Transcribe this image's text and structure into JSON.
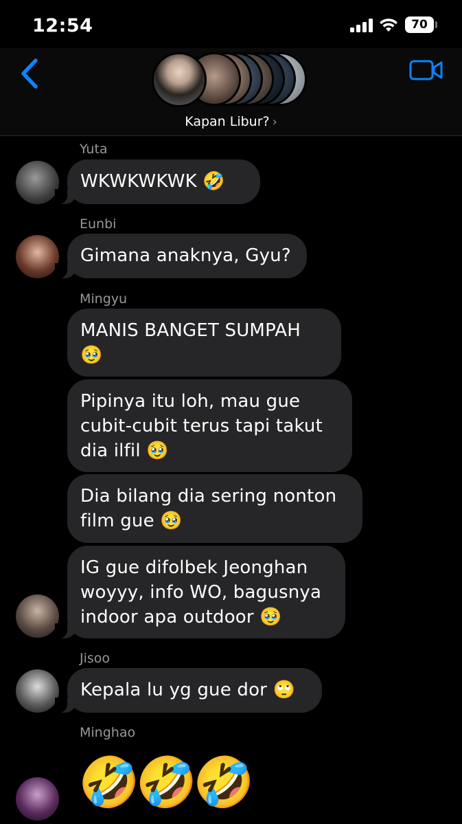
{
  "status_bar": {
    "time": "12:54",
    "battery": "70"
  },
  "header": {
    "group_name": "Kapan Libur?",
    "chevron": "›"
  },
  "messages": [
    {
      "sender": "Yuta",
      "text": "WKWKWKWK 🤣"
    },
    {
      "sender": "Eunbi",
      "text": "Gimana anaknya, Gyu?"
    },
    {
      "sender": "Mingyu",
      "texts": [
        "MANIS BANGET SUMPAH 🥹",
        "Pipinya itu loh, mau gue cubit-cubit terus tapi takut dia ilfil 🥹",
        "Dia bilang dia sering nonton film gue 🥹",
        "IG gue difolbek Jeonghan woyyy, info WO, bagusnya indoor apa outdoor 🥹"
      ]
    },
    {
      "sender": "Jisoo",
      "text": "Kepala lu yg gue dor 🙄"
    },
    {
      "sender": "Minghao",
      "text": "🤣🤣🤣"
    }
  ],
  "colors": {
    "accent": "#0a84ff",
    "bubble": "#262628",
    "background": "#000000",
    "sender_label": "#98989d"
  },
  "icons": {
    "back": "chevron-left-icon",
    "video": "video-camera-icon",
    "wifi": "wifi-icon",
    "signal": "cellular-signal-icon",
    "battery": "battery-icon"
  }
}
